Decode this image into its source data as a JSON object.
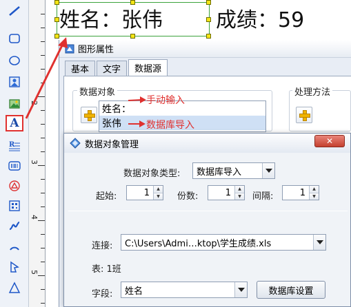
{
  "canvas": {
    "name_label": "姓名：张伟",
    "score_label": "成绩：59"
  },
  "ruler": {
    "marks": [
      "2",
      "3",
      "4",
      "5"
    ]
  },
  "toolbar": {
    "tools": [
      "line-tool-icon",
      "rounded-rect-tool-icon",
      "ellipse-tool-icon",
      "image-frame-tool-icon",
      "picture-tool-icon",
      "text-tool-icon",
      "rich-text-tool-icon",
      "barcode-tool-icon",
      "qr-code-tool-icon",
      "data-matrix-tool-icon",
      "curve-tool-icon",
      "arc-tool-icon",
      "polygon-tool-icon",
      "triangle-tool-icon"
    ],
    "text_tool_glyph": "A"
  },
  "properties_window": {
    "title": "图形属性",
    "tabs": [
      "基本",
      "文字",
      "数据源"
    ],
    "active_tab": "数据源",
    "data_object_group": "数据对象",
    "processing_group": "处理方法",
    "data_items": [
      "姓名：",
      "张伟"
    ]
  },
  "annotations": {
    "manual_input": "手动输入",
    "db_import": "数据库导入"
  },
  "dialog": {
    "title": "数据对象管理",
    "close_glyph": "✕",
    "type_label": "数据对象类型:",
    "type_value": "数据库导入",
    "start_label": "起始:",
    "start_value": "1",
    "copies_label": "份数:",
    "copies_value": "1",
    "interval_label": "间隔:",
    "interval_value": "1",
    "connection_label": "连接:",
    "connection_value": "C:\\Users\\Admi…ktop\\学生成绩.xls",
    "table_label": "表: 1班",
    "field_label": "字段:",
    "field_value": "姓名",
    "db_settings_button": "数据库设置"
  },
  "colors": {
    "annotation": "#e0312f",
    "selection": "#3aa23a",
    "handle": "#f4e516",
    "list_selected": "#cfe0f5"
  }
}
